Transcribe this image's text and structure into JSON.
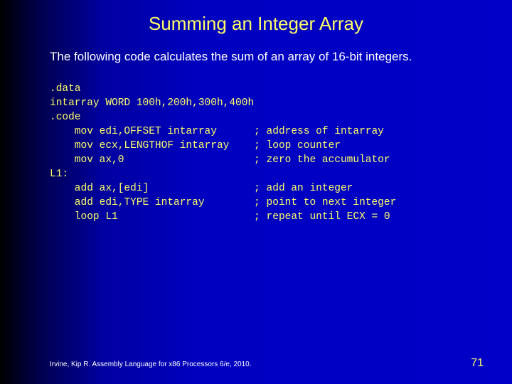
{
  "slide": {
    "title": "Summing an Integer Array",
    "intro": "The following code calculates the sum of an array of 16-bit integers.",
    "code": ".data\nintarray WORD 100h,200h,300h,400h\n.code\n    mov edi,OFFSET intarray      ; address of intarray\n    mov ecx,LENGTHOF intarray    ; loop counter\n    mov ax,0                     ; zero the accumulator\nL1:\n    add ax,[edi]                 ; add an integer\n    add edi,TYPE intarray        ; point to next integer\n    loop L1                      ; repeat until ECX = 0",
    "footer_left": "Irvine, Kip R. Assembly Language for x86 Processors 6/e, 2010.",
    "page_number": "71"
  }
}
